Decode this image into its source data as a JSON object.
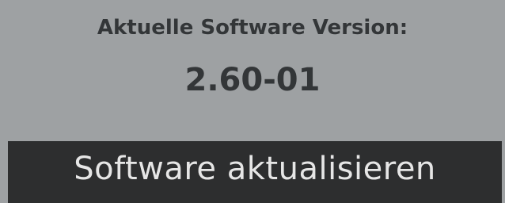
{
  "colors": {
    "panel_background": "#9ea1a3",
    "text_dark": "#333638",
    "button_background": "#2d2e2f",
    "button_text": "#e6e6e6"
  },
  "version_panel": {
    "label": "Aktuelle Software Version:",
    "value": "2.60-01"
  },
  "update_button": {
    "label": "Software aktualisieren"
  }
}
